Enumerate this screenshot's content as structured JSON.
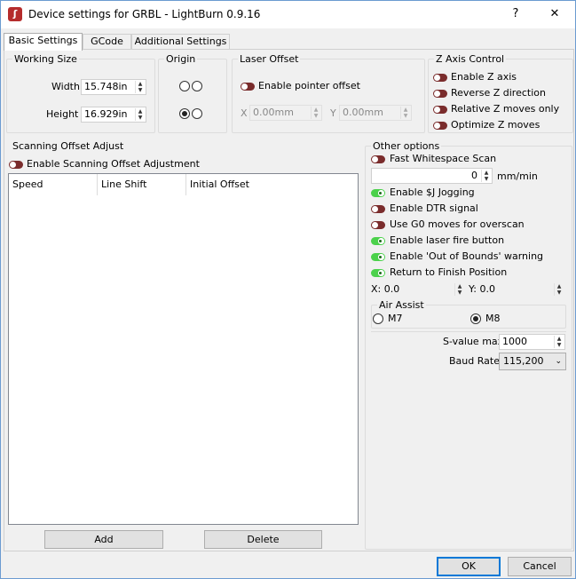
{
  "window": {
    "title": "Device settings for GRBL - LightBurn 0.9.16",
    "help_label": "?",
    "close_label": "✕",
    "icon": "lightburn-icon"
  },
  "tabs": [
    {
      "label": "Basic Settings",
      "active": true
    },
    {
      "label": "GCode",
      "active": false
    },
    {
      "label": "Additional Settings",
      "active": false
    }
  ],
  "working_size": {
    "title": "Working Size",
    "width_label": "Width",
    "width_value": "15.748in",
    "height_label": "Height",
    "height_value": "16.929in"
  },
  "origin": {
    "title": "Origin"
  },
  "laser_offset": {
    "title": "Laser Offset",
    "enable_label": "Enable pointer offset",
    "x_label": "X",
    "x_value": "0.00mm",
    "y_label": "Y",
    "y_value": "0.00mm"
  },
  "z_axis": {
    "title": "Z Axis Control",
    "items": [
      {
        "label": "Enable Z axis",
        "on": false
      },
      {
        "label": "Reverse Z direction",
        "on": false
      },
      {
        "label": "Relative Z moves only",
        "on": false
      },
      {
        "label": "Optimize Z moves",
        "on": false
      }
    ]
  },
  "scanning": {
    "title": "Scanning Offset Adjust",
    "enable_label": "Enable Scanning Offset Adjustment",
    "columns": [
      "Speed",
      "Line Shift",
      "Initial Offset"
    ],
    "add_label": "Add",
    "delete_label": "Delete"
  },
  "other": {
    "title": "Other options",
    "fast_whitespace_label": "Fast Whitespace Scan",
    "speed_value": "0",
    "speed_unit": "mm/min",
    "options": [
      {
        "label": "Enable $J Jogging",
        "on": true
      },
      {
        "label": "Enable DTR signal",
        "on": false
      },
      {
        "label": "Use G0 moves for overscan",
        "on": false
      },
      {
        "label": "Enable laser fire button",
        "on": true
      },
      {
        "label": "Enable 'Out of Bounds' warning",
        "on": true
      },
      {
        "label": "Return to Finish Position",
        "on": true
      }
    ],
    "finish_x": "X: 0.0",
    "finish_y": "Y: 0.0",
    "air_assist_title": "Air Assist",
    "m7_label": "M7",
    "m8_label": "M8",
    "air_assist_selected": "M8",
    "svalue_label": "S-value max",
    "svalue_value": "1000",
    "baud_label": "Baud Rate",
    "baud_value": "115,200"
  },
  "footer": {
    "ok_label": "OK",
    "cancel_label": "Cancel"
  },
  "colors": {
    "toggle_off": "#7a2c2c",
    "toggle_on": "#4bd14b",
    "default_button_border": "#0078d7"
  }
}
